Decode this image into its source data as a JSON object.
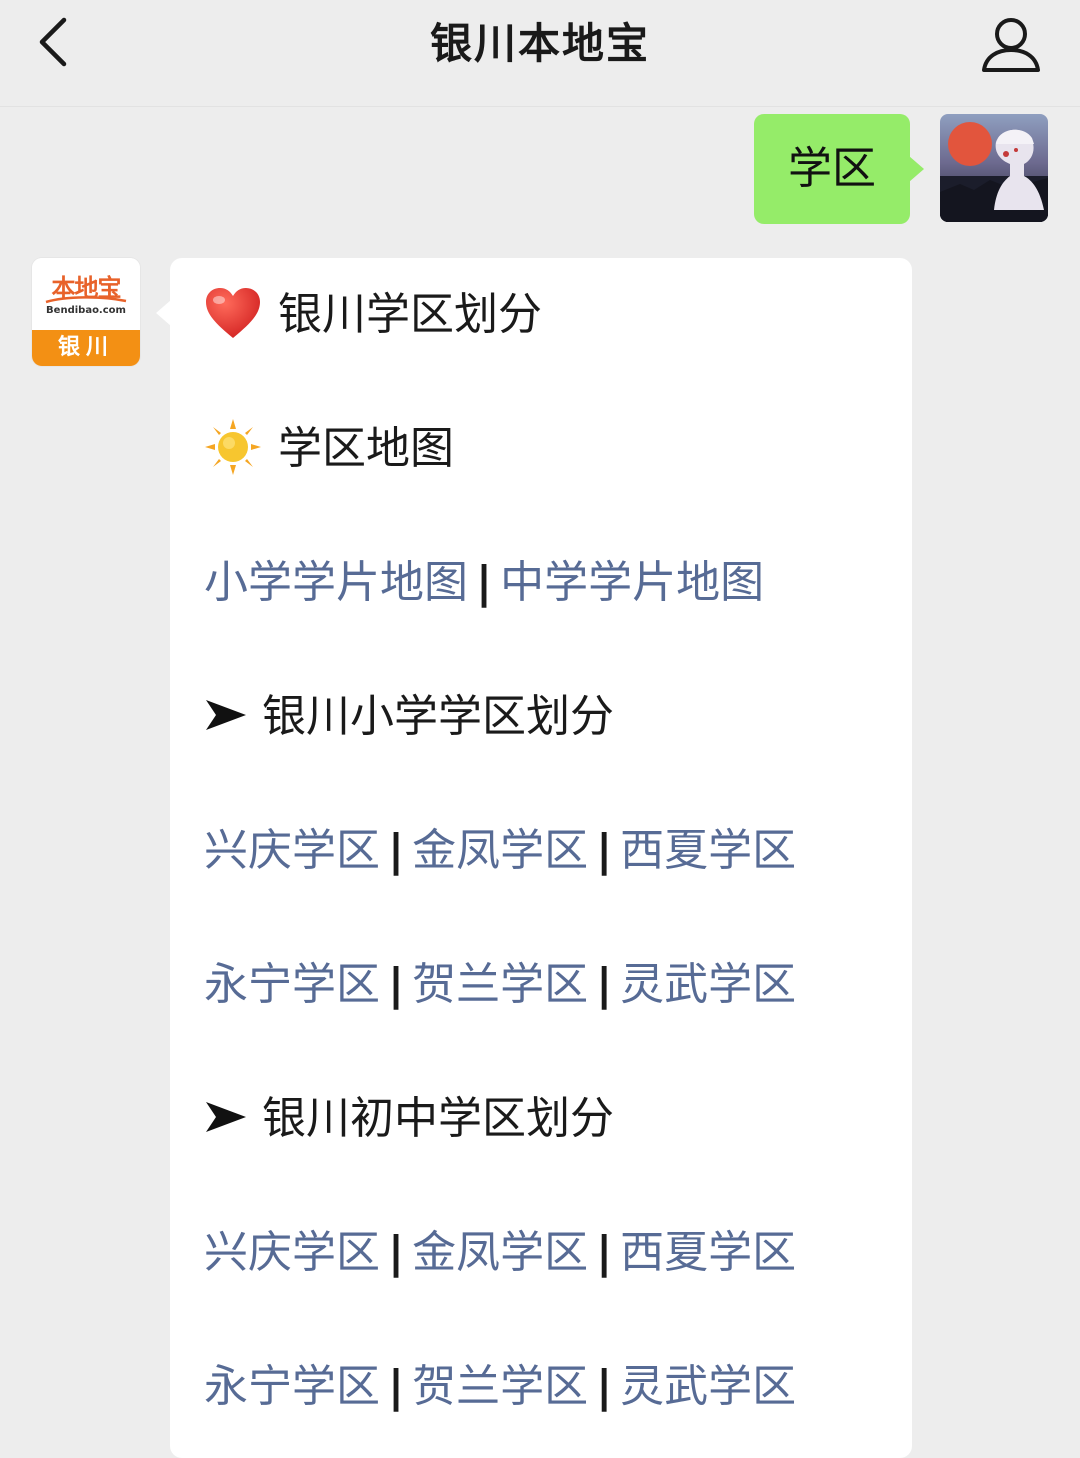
{
  "header": {
    "title": "银川本地宝"
  },
  "outgoing": {
    "text": "学区"
  },
  "bot": {
    "logo_name": "本地宝",
    "logo_domain": "Bendibao.com",
    "logo_city": "银川"
  },
  "message": {
    "heading1": "银川学区划分",
    "heading2": "学区地图",
    "map_links": [
      "小学学片地图",
      "中学学片地图"
    ],
    "primary_heading": "银川小学学区划分",
    "primary_row1": [
      "兴庆学区",
      "金凤学区",
      "西夏学区"
    ],
    "primary_row2": [
      "永宁学区",
      "贺兰学区",
      "灵武学区"
    ],
    "middle_heading": "银川初中学区划分",
    "middle_row1": [
      "兴庆学区",
      "金凤学区",
      "西夏学区"
    ],
    "middle_row2": [
      "永宁学区",
      "贺兰学区",
      "灵武学区"
    ],
    "separator": "|"
  },
  "icons": {
    "back": "chevron-left-icon",
    "profile": "user-icon",
    "heart": "heart-icon",
    "sun": "sun-icon",
    "arrow": "arrow-right-icon"
  },
  "colors": {
    "link": "#576b95",
    "outgoing_bubble": "#95ec69",
    "heart": "#e52d27",
    "sun": "#f7c62f",
    "logo_orange": "#f39014"
  }
}
